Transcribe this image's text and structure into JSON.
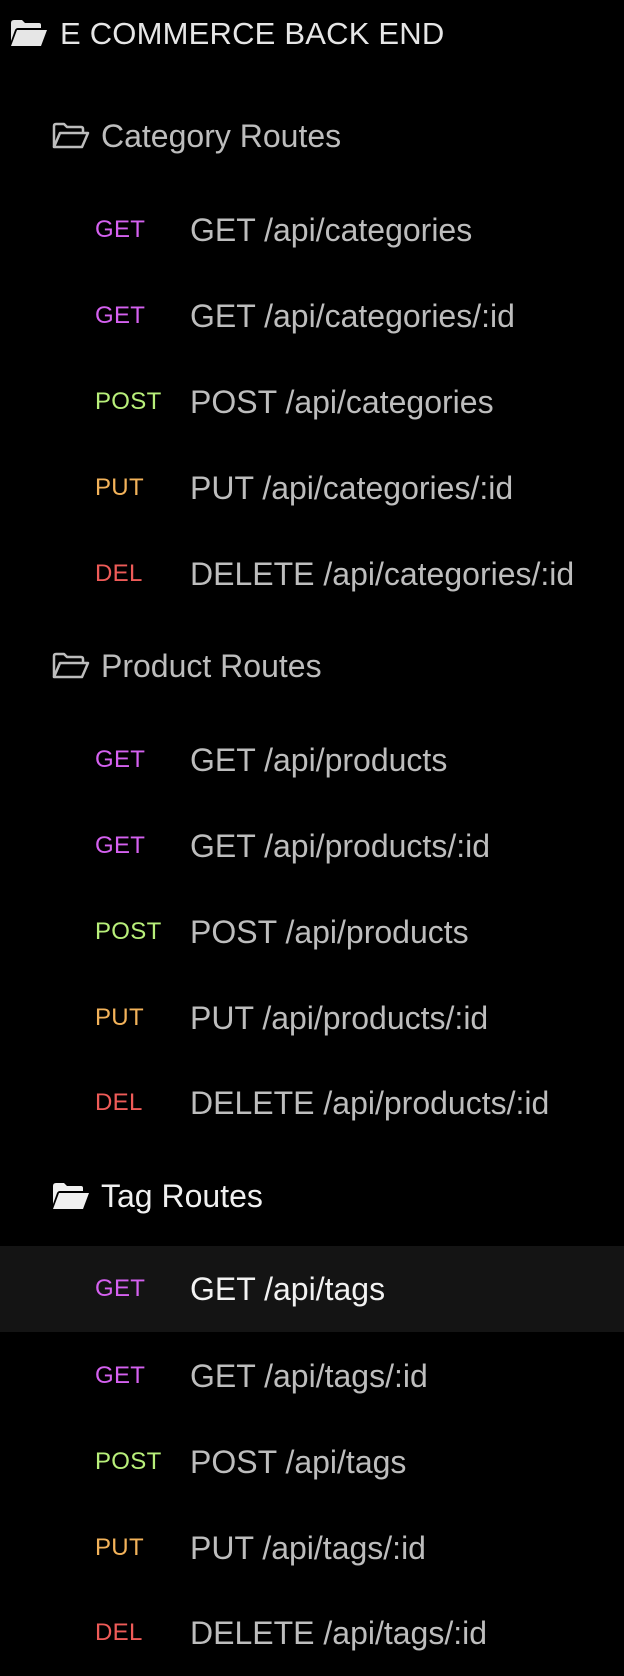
{
  "collection": {
    "title": "E COMMERCE BACK END",
    "icon": "folder-open-icon"
  },
  "groups": [
    {
      "label": "Category Routes",
      "icon": "folder-outline-icon",
      "routes": [
        {
          "method": "GET",
          "name": "GET /api/categories"
        },
        {
          "method": "GET",
          "name": "GET /api/categories/:id"
        },
        {
          "method": "POST",
          "name": "POST /api/categories"
        },
        {
          "method": "PUT",
          "name": "PUT /api/categories/:id"
        },
        {
          "method": "DEL",
          "name": "DELETE /api/categories/:id"
        }
      ]
    },
    {
      "label": "Product Routes",
      "icon": "folder-outline-icon",
      "routes": [
        {
          "method": "GET",
          "name": "GET /api/products"
        },
        {
          "method": "GET",
          "name": "GET /api/products/:id"
        },
        {
          "method": "POST",
          "name": "POST /api/products"
        },
        {
          "method": "PUT",
          "name": "PUT /api/products/:id"
        },
        {
          "method": "DEL",
          "name": "DELETE /api/products/:id"
        }
      ]
    },
    {
      "label": "Tag Routes",
      "icon": "folder-open-icon",
      "routes": [
        {
          "method": "GET",
          "name": "GET /api/tags"
        },
        {
          "method": "GET",
          "name": "GET /api/tags/:id"
        },
        {
          "method": "POST",
          "name": "POST /api/tags"
        },
        {
          "method": "PUT",
          "name": "PUT /api/tags/:id"
        },
        {
          "method": "DEL",
          "name": "DELETE /api/tags/:id"
        }
      ]
    }
  ],
  "selected_route": "GET /api/tags",
  "colors": {
    "background": "#000000",
    "get": "#d561f0",
    "post": "#b8ef7a",
    "put": "#f2b25a",
    "del": "#ee5b58",
    "selected_row": "#141414"
  }
}
